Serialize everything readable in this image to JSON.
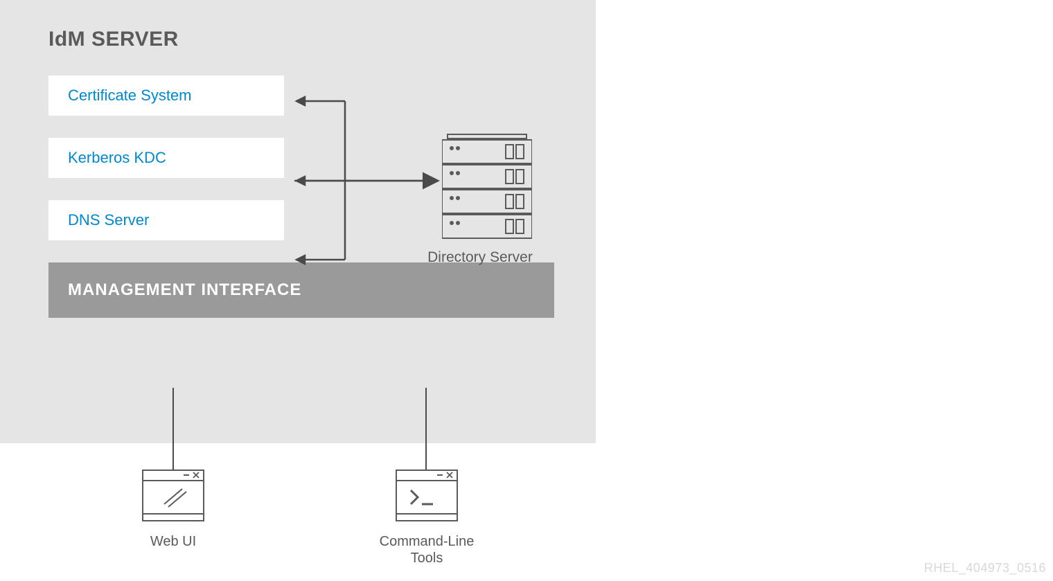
{
  "server_title": "IdM SERVER",
  "services": {
    "cert": "Certificate System",
    "kdc": "Kerberos KDC",
    "dns": "DNS Server"
  },
  "directory_label": "Directory Server",
  "management_label": "MANAGEMENT INTERFACE",
  "clients": {
    "webui": "Web UI",
    "cli_line1": "Command-Line",
    "cli_line2": "Tools"
  },
  "footer": "RHEL_404973_0516"
}
